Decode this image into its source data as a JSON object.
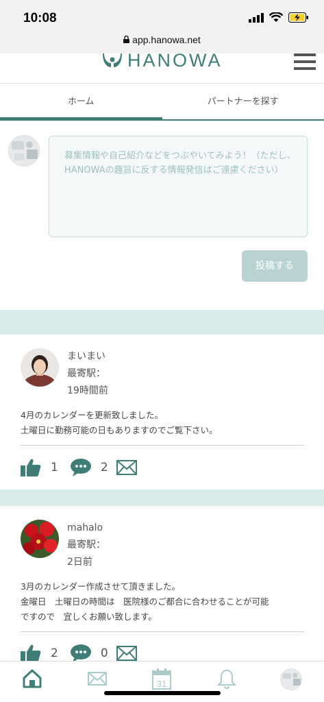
{
  "status_bar": {
    "time": "10:08",
    "url": "app.hanowa.net"
  },
  "header": {
    "logo_text": "HANOWA"
  },
  "tabs": [
    {
      "label": "ホーム",
      "active": true
    },
    {
      "label": "パートナーを探す",
      "active": false
    }
  ],
  "composer": {
    "placeholder": "募集情報や自己紹介などをつぶやいてみよう！（ただし、HANOWAの趣旨に反する情報発信はご遠慮ください）",
    "post_label": "投稿する"
  },
  "posts": [
    {
      "name": "まいまい",
      "station": "最寄駅：",
      "time": "19時間前",
      "body_line1": "4月のカレンダーを更新致しました。",
      "body_line2": "土曜日に勤務可能の日もありますのでご覧下さい。",
      "likes": "1",
      "comments": "2"
    },
    {
      "name": "mahalo",
      "station": "最寄駅：",
      "time": "2日前",
      "body_line1": "3月のカレンダー作成させて頂きました。",
      "body_line2": "金曜日　土曜日の時間は　医院様のご都合に合わせることが可能",
      "body_line3": "ですので　宜しくお願い致します。",
      "likes": "2",
      "comments": "0"
    }
  ],
  "bottom_nav": {
    "calendar_day": "31",
    "items": [
      "home-icon",
      "mail-icon",
      "calendar-icon",
      "bell-icon",
      "profile-avatar"
    ]
  },
  "colors": {
    "accent": "#3f7d78",
    "band": "#dbebeb",
    "button_disabled": "#b9d3d2"
  }
}
